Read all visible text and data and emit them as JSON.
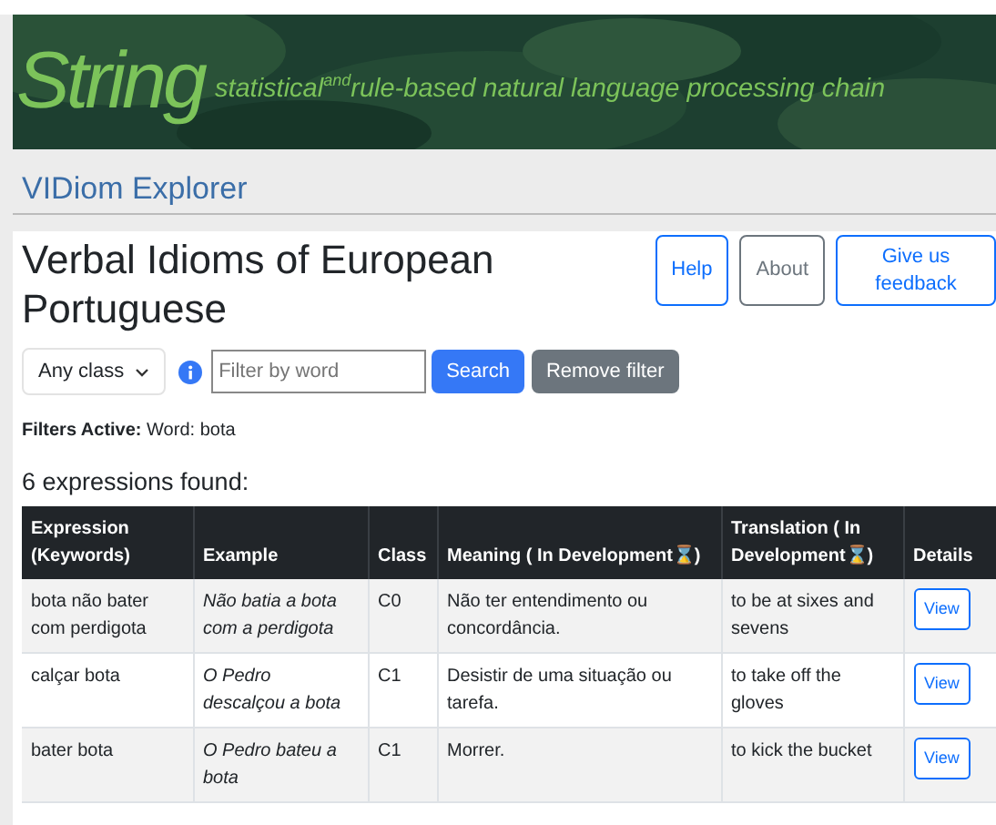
{
  "banner": {
    "logo": "String",
    "tagline": "statistical$^{and}$rule-based natural language processing chain"
  },
  "app_title": "VIDiom Explorer",
  "page_title": "Verbal Idioms of European Portuguese",
  "header_buttons": [
    {
      "label": "Help",
      "kind": "primary"
    },
    {
      "label": "About",
      "kind": "secondary"
    },
    {
      "label": "Give us feedback",
      "kind": "primary"
    }
  ],
  "filter_bar": {
    "class_select": "Any class",
    "search": {
      "placeholder": "Filter by word"
    },
    "search_button": "Search",
    "remove_button": "Remove filter"
  },
  "filters_active": {
    "label": "Filters Active:",
    "value": "Word: bota"
  },
  "result_count": "6 expressions found:",
  "table": {
    "columns": [
      "Expression (Keywords)",
      "Example",
      "Class",
      "Meaning ( In Development⌛)",
      "Translation ( In Development⌛)",
      "Details"
    ],
    "rows": [
      {
        "expression": "bota não bater com perdigota",
        "example": "Não batia a bota com a perdigota",
        "class": "C0",
        "meaning": "Não ter entendimento ou concordância.",
        "translation": "to be at sixes and sevens",
        "details": "View"
      },
      {
        "expression": "calçar bota",
        "example": "O Pedro descalçou a bota",
        "class": "C1",
        "meaning": "Desistir de uma situação ou tarefa.",
        "translation": "to take off the gloves",
        "details": "View"
      },
      {
        "expression": "bater bota",
        "example": "O Pedro bateu a bota",
        "class": "C1",
        "meaning": "Morrer.",
        "translation": "to kick the bucket",
        "details": "View"
      }
    ]
  }
}
